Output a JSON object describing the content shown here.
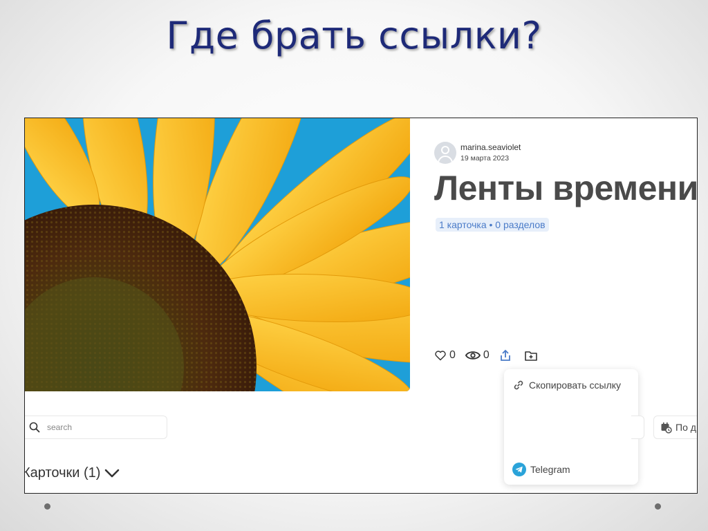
{
  "slide": {
    "title": "Где брать ссылки?"
  },
  "post": {
    "author": "marina.seaviolet",
    "date": "19 марта 2023",
    "title": "Ленты времени",
    "badge": "1 карточка • 0 разделов",
    "likes": "0",
    "views": "0"
  },
  "share_menu": {
    "copy_link": "Скопировать ссылку",
    "telegram": "Telegram"
  },
  "search": {
    "placeholder": "search"
  },
  "sort": {
    "label": "По д"
  },
  "cards": {
    "heading": "Карточки (1)"
  },
  "colors": {
    "slide_title": "#1e2a78",
    "badge_bg": "#e7effa",
    "badge_text": "#4a7bc8",
    "share_icon": "#4a7bc8",
    "telegram": "#2aa3d9",
    "sky": "#1e9fd8",
    "petal": "#f5b316"
  },
  "icons": [
    "heart-icon",
    "eye-icon",
    "share-icon",
    "folder-add-icon",
    "link-icon",
    "telegram-icon",
    "search-icon",
    "calendar-sort-icon",
    "chevron-down-icon",
    "user-avatar-icon"
  ]
}
